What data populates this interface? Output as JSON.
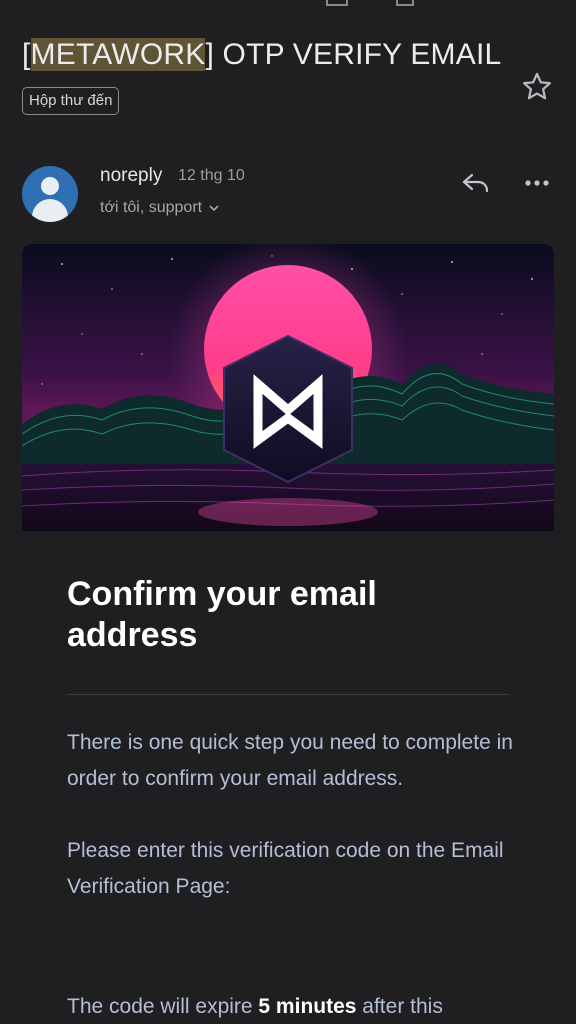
{
  "email": {
    "subject_prefix": "[",
    "subject_highlight": "METAWORK",
    "subject_rest": "] OTP VERIFY EMAIL",
    "label": "Hộp thư đến",
    "sender": "noreply",
    "date": "12 thg 10",
    "recipients": "tới tôi, support"
  },
  "body": {
    "heading": "Confirm your email address",
    "para1": "There is one quick step you need to complete in order to confirm your email address.",
    "para2": "Please enter this verification code on the Email Verification Page:",
    "para3_pre": "The code will expire ",
    "para3_bold": "5 minutes",
    "para3_post": " after this"
  },
  "icons": {
    "star": "star-icon",
    "reply": "reply-icon",
    "more": "more-icon",
    "logo": "metawork-logo-icon"
  },
  "colors": {
    "background": "#1f1f21",
    "avatar": "#2f6fb3",
    "body_text": "#b4bed6",
    "highlight": "#5f5535"
  }
}
